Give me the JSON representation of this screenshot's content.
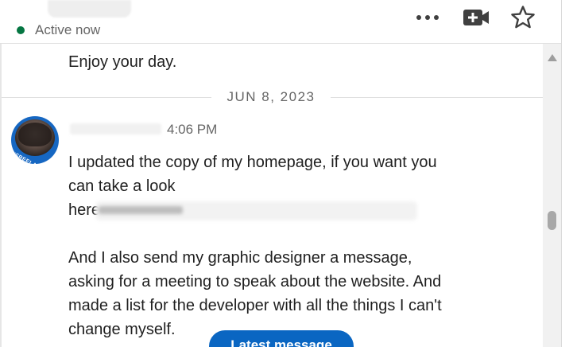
{
  "header": {
    "status_text": "Active now",
    "status_color": "#057642",
    "icons": [
      "more-icon",
      "video-call-icon",
      "star-icon"
    ]
  },
  "thread": {
    "previous_message": "Enjoy your day.",
    "date_divider": "JUN 8, 2023",
    "message": {
      "time": "4:06 PM",
      "avatar_badge": "#FREELANCE",
      "lines": [
        "I updated the copy of my homepage, if you want you",
        "can take a look",
        "here",
        "And I also send my graphic designer a message,",
        "asking for a meeting to speak about the website. And",
        "made a list for the developer with all the things I can't",
        "change myself."
      ]
    },
    "latest_button_label": "Latest message"
  },
  "colors": {
    "accent": "#0a66c2",
    "text_primary": "#1f1f1f",
    "text_secondary": "#666666"
  }
}
